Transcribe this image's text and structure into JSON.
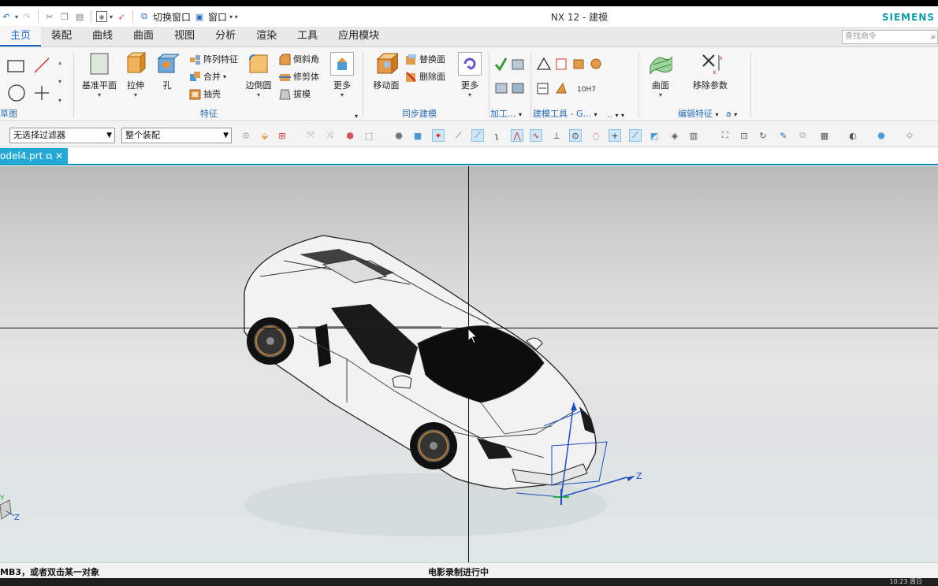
{
  "window": {
    "title": "NX 12 - 建模",
    "brand": "SIEMENS",
    "brand_color": "#0b9aa8"
  },
  "quick_access": {
    "switch_window": "切换窗口",
    "window_menu": "窗口"
  },
  "tabs": [
    "主页",
    "装配",
    "曲线",
    "曲面",
    "视图",
    "分析",
    "渲染",
    "工具",
    "应用模块"
  ],
  "active_tab": "主页",
  "search": {
    "placeholder": "查找命令"
  },
  "ribbon": {
    "sketch_group_label": "草图",
    "feature": {
      "datum_plane": "基准平面",
      "extrude": "拉伸",
      "hole": "孔",
      "pattern_feature": "阵列特征",
      "unite": "合并",
      "shell": "抽壳",
      "edge_blend": "边倒圆",
      "chamfer": "倒斜角",
      "trim_body": "修剪体",
      "draft": "拔模",
      "more": "更多",
      "group_label": "特征"
    },
    "sync": {
      "move_face": "移动面",
      "replace_face": "替换面",
      "delete_face": "删除面",
      "more": "更多",
      "group_label": "同步建模"
    },
    "machining": {
      "group_label": "加工..."
    },
    "modeling_tools": {
      "group_label": "建模工具 - G..."
    },
    "surface": {
      "surface": "曲面"
    },
    "edit_feature": {
      "remove_params": "移除参数",
      "group_label": "编辑特征"
    },
    "misc_label": "..",
    "misc_label2": "a"
  },
  "filter_bar": {
    "type_filter": "无选择过滤器",
    "scope_filter": "整个装配"
  },
  "document_tab": {
    "name": "odel4.prt"
  },
  "viewport": {
    "csys_z": "Z",
    "csys_y": "Y",
    "mini_z": "Z"
  },
  "status": {
    "prompt": "MB3，或者双击某一对象",
    "message": "电影录制进行中"
  },
  "taskbar": {
    "clock": "10:23 周日"
  }
}
